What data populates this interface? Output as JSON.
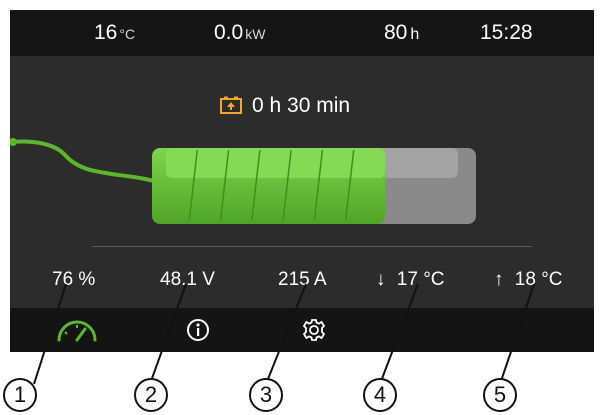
{
  "status_bar": {
    "outdoor_temp": {
      "value": "16",
      "unit": "°C"
    },
    "power": {
      "value": "0.0",
      "unit": "kW"
    },
    "operating_hours": {
      "value": "80",
      "unit": "h"
    },
    "clock": "15:28"
  },
  "charging": {
    "time_remaining": "0 h 30 min",
    "charge_level_fraction": 0.76,
    "icon": "battery-charging-icon"
  },
  "readings": {
    "state_of_charge": "76 %",
    "voltage": "48.1 V",
    "current": "215 A",
    "temp_min": {
      "arrow": "↓",
      "value": "17 °C"
    },
    "temp_max": {
      "arrow": "↑",
      "value": "18 °C"
    }
  },
  "nav": {
    "items": [
      {
        "icon": "gauge-icon",
        "active": true
      },
      {
        "icon": "info-icon",
        "active": false
      },
      {
        "icon": "gear-icon",
        "active": false
      }
    ]
  },
  "callouts": [
    "1",
    "2",
    "3",
    "4",
    "5"
  ],
  "colors": {
    "active_accent": "#5cb82a",
    "battery_charged": "#6ac43a",
    "battery_empty": "#8a8a8a",
    "timer_icon": "#f5a623",
    "screen_bg": "#2c2c2c",
    "bar_bg": "#151515"
  }
}
